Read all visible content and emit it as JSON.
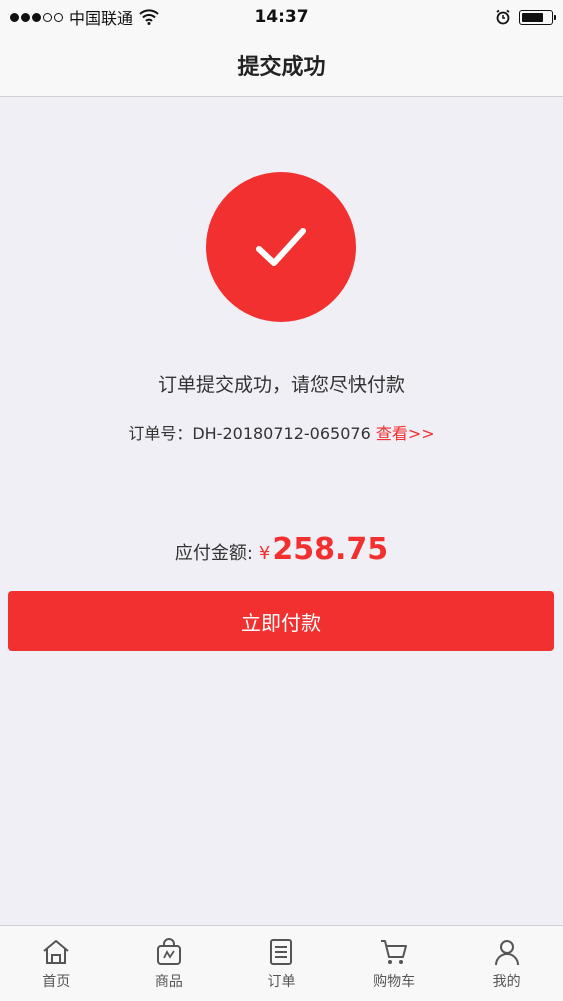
{
  "status_bar": {
    "carrier": "中国联通",
    "time": "14:37",
    "icons": [
      "signal-dots-icon",
      "wifi-icon",
      "alarm-icon",
      "battery-icon"
    ],
    "battery_fraction": 0.75
  },
  "header": {
    "title": "提交成功"
  },
  "result": {
    "icon": "check-icon",
    "message": "订单提交成功，请您尽快付款",
    "order_label": "订单号：",
    "order_number": "DH-20180712-065076",
    "view_link": "查看>>"
  },
  "payment": {
    "amount_label": "应付金额:",
    "currency_symbol": "¥",
    "amount": "258.75",
    "button_label": "立即付款"
  },
  "tab_bar": {
    "items": [
      {
        "label": "首页",
        "icon": "home-icon"
      },
      {
        "label": "商品",
        "icon": "shopping-bag-icon"
      },
      {
        "label": "订单",
        "icon": "order-list-icon"
      },
      {
        "label": "购物车",
        "icon": "cart-icon"
      },
      {
        "label": "我的",
        "icon": "user-icon"
      }
    ]
  },
  "colors": {
    "accent": "#f23030",
    "background": "#f0eff5",
    "bar": "#f8f8f8"
  }
}
